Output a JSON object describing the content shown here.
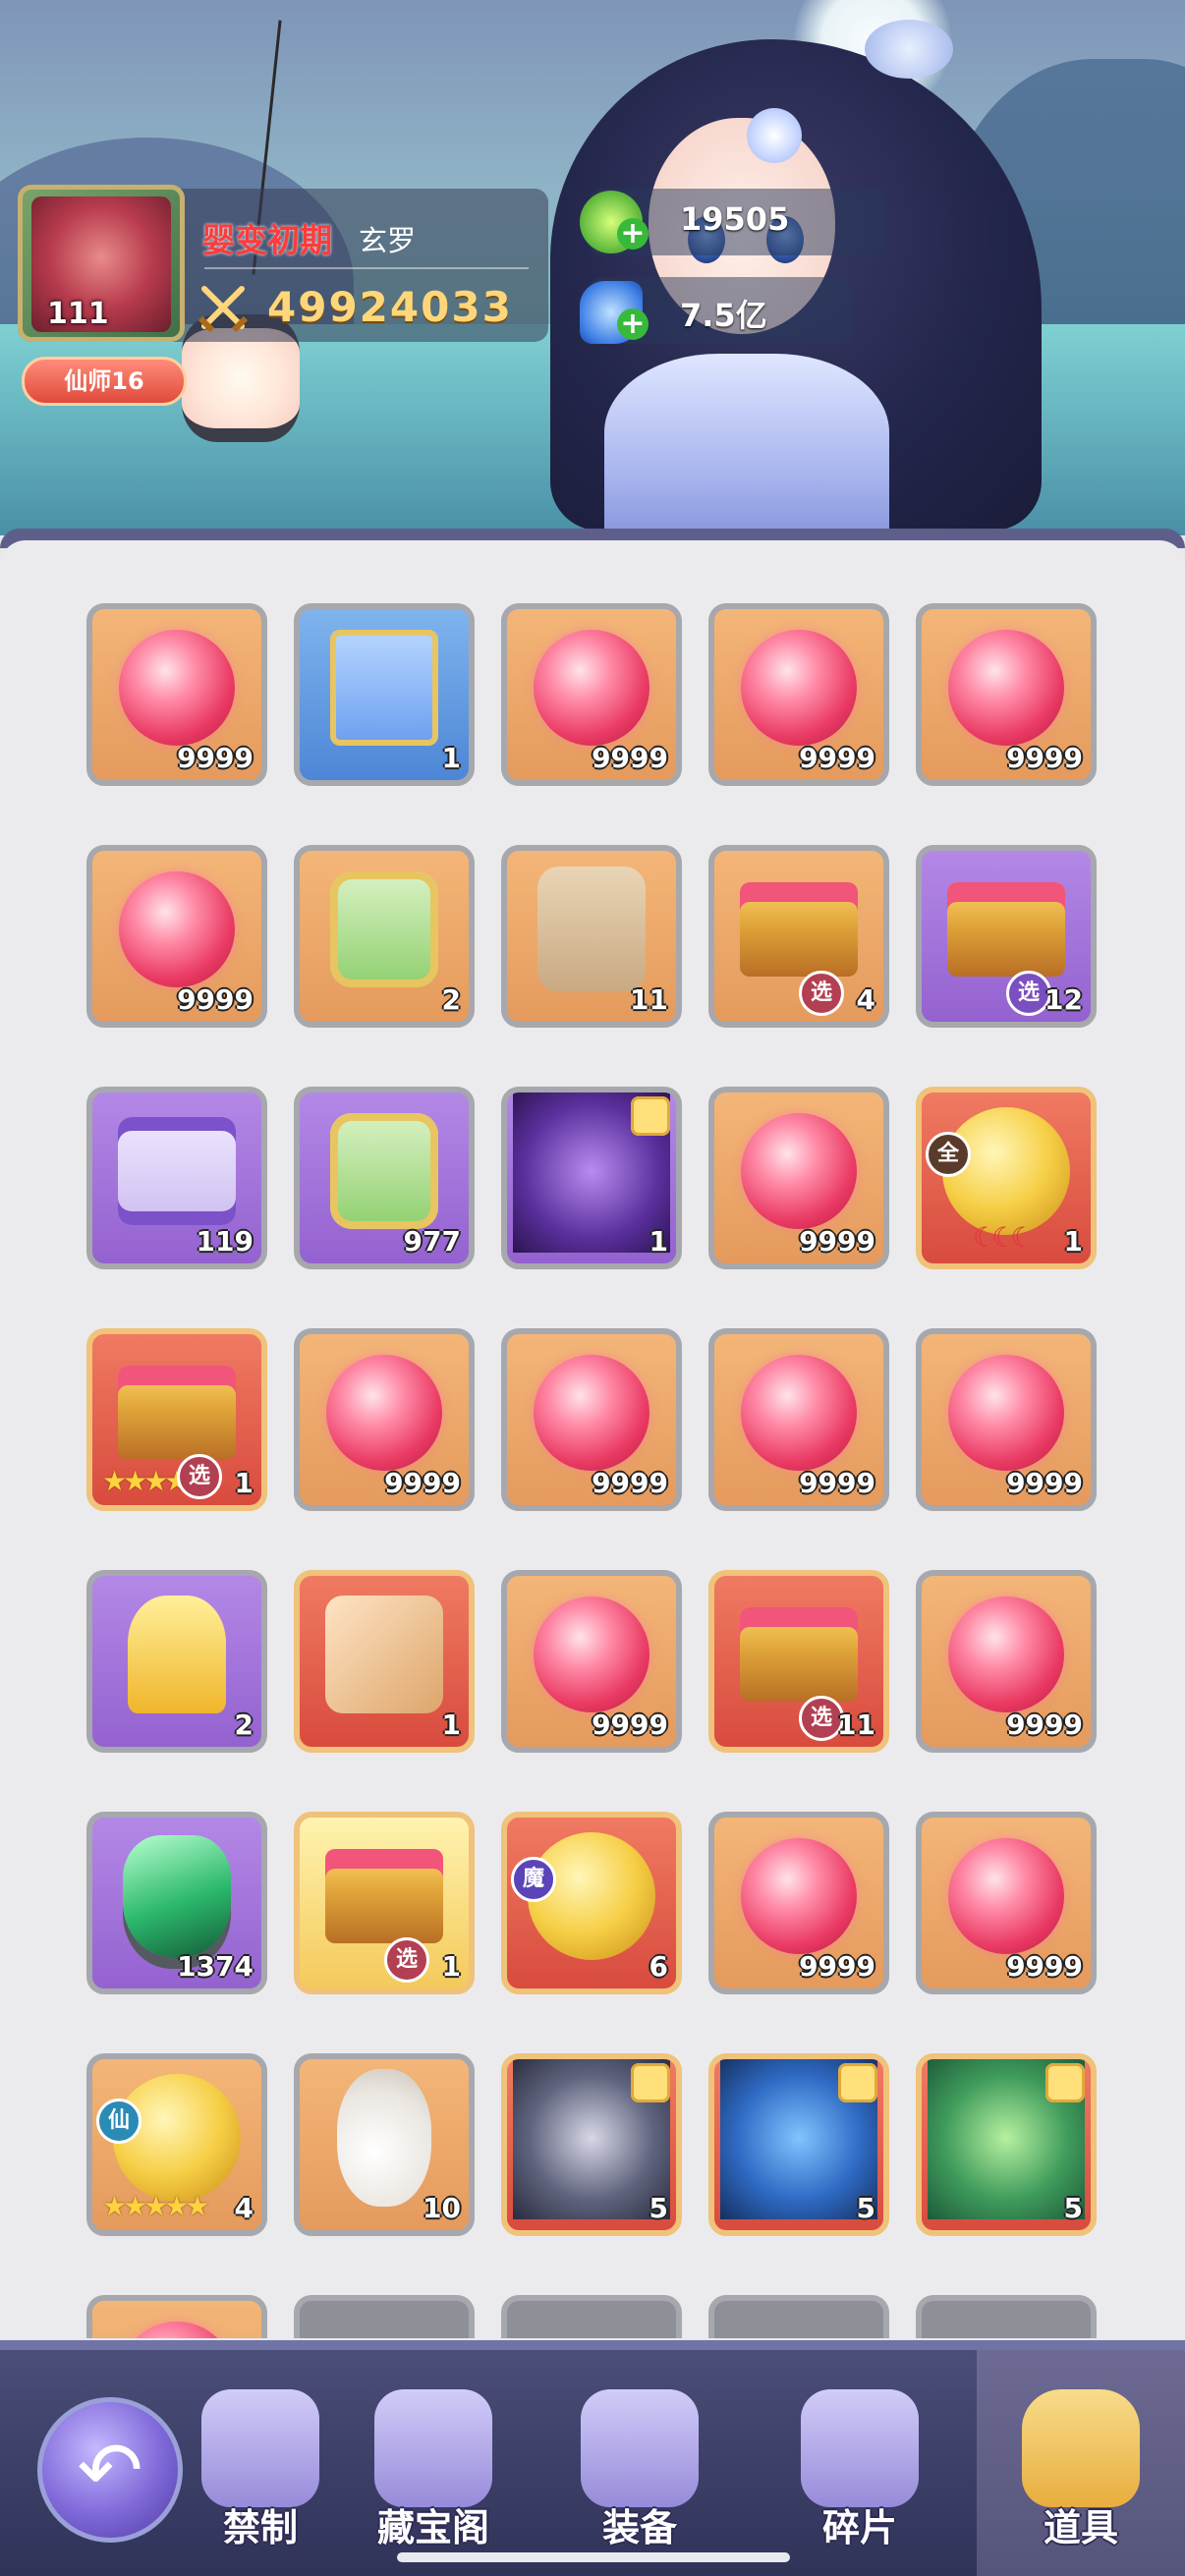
{
  "player": {
    "level": "111",
    "rank": "仙师16",
    "realm": "婴变初期",
    "name": "玄罗",
    "power": "49924033"
  },
  "currency": [
    {
      "icon": "jade-currency-icon",
      "value": "19505"
    },
    {
      "icon": "crystal-currency-icon",
      "value": "7.5亿"
    }
  ],
  "inventory": [
    {
      "kind": "orb",
      "bg": "orange",
      "qty": "9999"
    },
    {
      "kind": "book",
      "bg": "blue",
      "qty": "1"
    },
    {
      "kind": "orb",
      "bg": "orange",
      "qty": "9999"
    },
    {
      "kind": "orb",
      "bg": "orange",
      "qty": "9999"
    },
    {
      "kind": "orb",
      "bg": "orange",
      "qty": "9999"
    },
    {
      "kind": "orb",
      "bg": "orange",
      "qty": "9999"
    },
    {
      "kind": "token",
      "bg": "orange",
      "qty": "2"
    },
    {
      "kind": "talisman",
      "bg": "orange",
      "qty": "11"
    },
    {
      "kind": "chest",
      "bg": "orange",
      "qty": "4",
      "badge": "选"
    },
    {
      "kind": "chest",
      "bg": "purple",
      "qty": "12",
      "badge": "选"
    },
    {
      "kind": "scroll",
      "bg": "purple",
      "qty": "119"
    },
    {
      "kind": "token",
      "bg": "purple",
      "qty": "977"
    },
    {
      "kind": "monster",
      "bg": "purple",
      "qty": "1",
      "puzzle": true
    },
    {
      "kind": "orb",
      "bg": "orange",
      "qty": "9999"
    },
    {
      "kind": "goldcoin",
      "bg": "red",
      "qty": "1",
      "tag": "全",
      "moons": true
    },
    {
      "kind": "chest",
      "bg": "red",
      "qty": "1",
      "badge": "选",
      "stars": "★★★★"
    },
    {
      "kind": "orb",
      "bg": "orange",
      "qty": "9999"
    },
    {
      "kind": "orb",
      "bg": "orange",
      "qty": "9999"
    },
    {
      "kind": "orb",
      "bg": "orange",
      "qty": "9999"
    },
    {
      "kind": "orb",
      "bg": "orange",
      "qty": "9999"
    },
    {
      "kind": "key",
      "bg": "purple",
      "qty": "2"
    },
    {
      "kind": "dice",
      "bg": "red",
      "qty": "1"
    },
    {
      "kind": "orb",
      "bg": "orange",
      "qty": "9999"
    },
    {
      "kind": "chest",
      "bg": "red",
      "qty": "11",
      "badge": "选"
    },
    {
      "kind": "orb",
      "bg": "orange",
      "qty": "9999"
    },
    {
      "kind": "gem",
      "bg": "purple",
      "qty": "1374"
    },
    {
      "kind": "chest",
      "bg": "gold",
      "qty": "1",
      "badge": "选"
    },
    {
      "kind": "goldcoin",
      "bg": "red",
      "qty": "6",
      "tag": "魔"
    },
    {
      "kind": "orb",
      "bg": "orange",
      "qty": "9999"
    },
    {
      "kind": "orb",
      "bg": "orange",
      "qty": "9999"
    },
    {
      "kind": "goldcoin",
      "bg": "orange",
      "qty": "4",
      "tag": "仙",
      "stars": "★★★★★"
    },
    {
      "kind": "gourd",
      "bg": "orange",
      "qty": "10"
    },
    {
      "kind": "monster-grey",
      "bg": "red",
      "qty": "5",
      "puzzle": true
    },
    {
      "kind": "monster-blue",
      "bg": "red",
      "qty": "5",
      "puzzle": true
    },
    {
      "kind": "monster-green",
      "bg": "red",
      "qty": "5",
      "puzzle": true
    },
    {
      "kind": "orb",
      "bg": "orange",
      "qty": ""
    },
    {
      "kind": "empty",
      "bg": "empty",
      "qty": ""
    },
    {
      "kind": "empty",
      "bg": "empty",
      "qty": ""
    },
    {
      "kind": "empty",
      "bg": "empty",
      "qty": ""
    },
    {
      "kind": "empty",
      "bg": "empty",
      "qty": ""
    }
  ],
  "nav": {
    "tabs": [
      {
        "label": "禁制",
        "icon": "restriction-icon"
      },
      {
        "label": "藏宝阁",
        "icon": "treasure-pavilion-icon"
      },
      {
        "label": "装备",
        "icon": "equipment-icon"
      },
      {
        "label": "碎片",
        "icon": "shard-icon"
      },
      {
        "label": "道具",
        "icon": "items-bag-icon",
        "selected": true
      }
    ],
    "back_icon": "back-arrow-icon"
  }
}
